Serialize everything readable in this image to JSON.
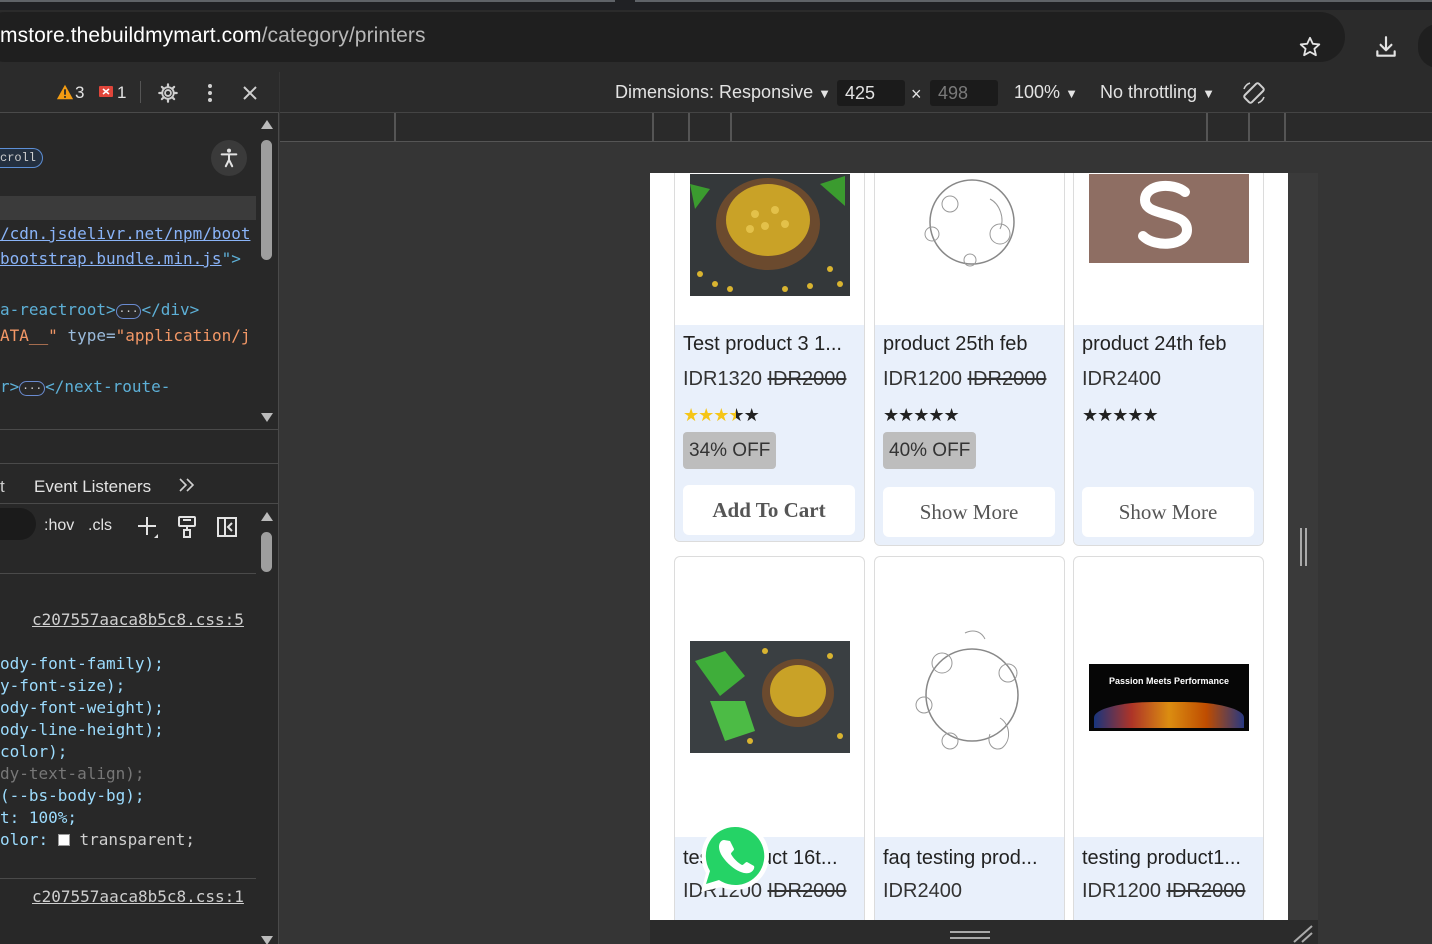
{
  "browser": {
    "url_host": "mstore.thebuildmymart.com",
    "url_path": "/category/printers"
  },
  "devtools": {
    "warnings_count": "3",
    "errors_count": "1",
    "scroll_badge": "croll",
    "elements_lines": [
      {
        "text": "/cdn.jsdelivr.net/npm/boot",
        "kind": "link"
      },
      {
        "text": "bootstrap.bundle.min.js",
        "kind": "link"
      },
      {
        "text": "a-reactroot>",
        "kind": "tag"
      },
      {
        "text": "</div>",
        "kind": "tag"
      },
      {
        "text": "ATA__\"",
        "kind": "val"
      },
      {
        "text": "type=",
        "kind": "attr"
      },
      {
        "text": "\"application/j",
        "kind": "val"
      },
      {
        "text": "r>",
        "kind": "tag"
      },
      {
        "text": "</next-route-",
        "kind": "tag"
      }
    ],
    "tabs": {
      "prev_fragment": "t",
      "event_listeners": "Event Listeners",
      "more": ">>"
    },
    "styles_toolbar": {
      "hov": ":hov",
      "cls": ".cls"
    },
    "css_source_1": "c207557aaca8b5c8.css:5",
    "css_source_2": "c207557aaca8b5c8.css:1",
    "css_lines": [
      "ody-font-family);",
      "y-font-size);",
      "ody-font-weight);",
      "ody-line-height);",
      "color);",
      "dy-text-align);",
      "(--bs-body-bg);",
      "t: 100%;",
      "olor:",
      "transparent;"
    ]
  },
  "device_toolbar": {
    "dimensions": "Dimensions: Responsive",
    "width": "425",
    "height": "498",
    "times": "×",
    "zoom": "100%",
    "throttling": "No throttling"
  },
  "products": [
    {
      "title": "Test product 3 1...",
      "price": "IDR1320",
      "old_price": "IDR2000",
      "rating": 3.5,
      "discount": "34% OFF",
      "button": "Add To Cart",
      "image": "fenugreek-bowl-icon"
    },
    {
      "title": "product 25th feb",
      "price": "IDR1200",
      "old_price": "IDR2000",
      "rating": 0,
      "discount": "40% OFF",
      "button": "Show More",
      "image": "vegetable-sketch-icon"
    },
    {
      "title": "product 24th feb",
      "price": "IDR2400",
      "old_price": "",
      "rating": 0,
      "discount": "",
      "button": "Show More",
      "image": "letter-s-icon"
    },
    {
      "title": "test product 16t...",
      "price": "IDR1200",
      "old_price": "IDR2000",
      "image": "fenugreek-leaves-icon"
    },
    {
      "title": "faq testing prod...",
      "price": "IDR2400",
      "old_price": "",
      "image": "vegetable-sketch-icon"
    },
    {
      "title": "testing product1...",
      "price": "IDR1200",
      "old_price": "IDR2000",
      "image": "laptop-banner-icon",
      "banner_text": "Passion Meets Performance"
    }
  ],
  "stars_text": "★★★★★",
  "colors": {
    "star_filled": "#f5c518",
    "card_body_bg": "#e9f0fb",
    "whatsapp_green": "#25d366"
  }
}
